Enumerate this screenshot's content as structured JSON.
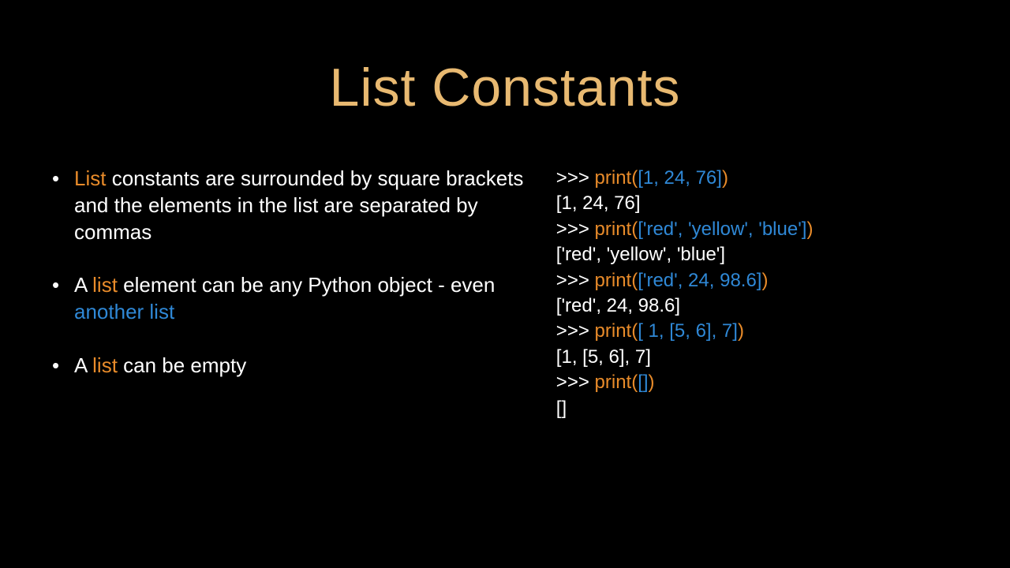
{
  "title": "List Constants",
  "bullets": [
    {
      "pre1": "",
      "hl1": "List",
      "mid1": " constants are surrounded by square brackets and the elements in the list are separated by commas",
      "hl2": "",
      "rest": ""
    },
    {
      "pre1": "A ",
      "hl1": "list",
      "mid1": " element can be any Python object - even ",
      "hl2": "another list",
      "rest": ""
    },
    {
      "pre1": "A ",
      "hl1": "list",
      "mid1": " can be empty",
      "hl2": "",
      "rest": ""
    }
  ],
  "code": {
    "l0_a": ">>> ",
    "l0_b": "print(",
    "l0_c": "[1, 24, 76]",
    "l0_d": ")",
    "l1": "[1, 24, 76]",
    "l2_a": ">>> ",
    "l2_b": "print(",
    "l2_c": "['red', 'yellow', 'blue']",
    "l2_d": ")",
    "l3": "['red', 'yellow', 'blue']",
    "l4_a": ">>> ",
    "l4_b": "print(",
    "l4_c": "['red', 24, 98.6]",
    "l4_d": ")",
    "l5": "['red', 24, 98.6]",
    "l6_a": ">>> ",
    "l6_b": "print(",
    "l6_c": "[ 1, [5, 6], 7]",
    "l6_d": ")",
    "l7": "[1, [5, 6], 7]",
    "l8_a": ">>> ",
    "l8_b": "print(",
    "l8_c": "[]",
    "l8_d": ")",
    "l9": "[]"
  }
}
